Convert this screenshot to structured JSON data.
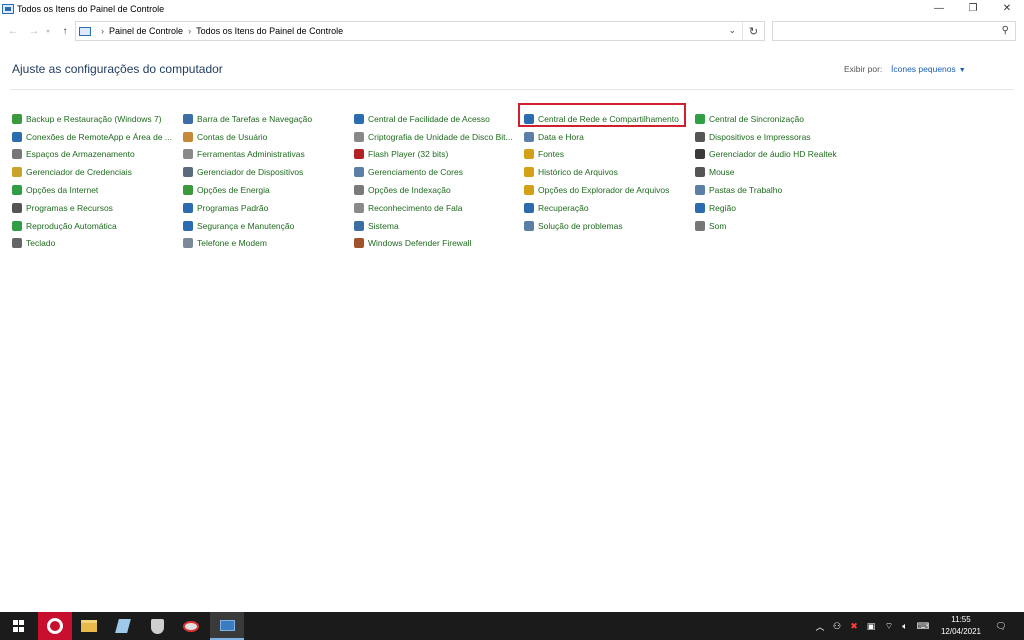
{
  "window": {
    "title": "Todos os Itens do Painel de Controle",
    "controls": [
      "minimize-icon",
      "restore-icon",
      "close-icon"
    ]
  },
  "address": {
    "crumbs": [
      "Painel de Controle",
      "Todos os Itens do Painel de Controle"
    ],
    "search_placeholder": ""
  },
  "header": {
    "title": "Ajuste as configurações do computador",
    "view_by_label": "Exibir por:",
    "view_by_value": "Ícones pequenos"
  },
  "columns": [
    [
      {
        "label": "Backup e Restauração (Windows 7)",
        "icon": "backup-icon",
        "color": "#3c9a3c"
      },
      {
        "label": "Conexões de RemoteApp e Área de ...",
        "icon": "remoteapp-icon",
        "color": "#2b6cb0"
      },
      {
        "label": "Espaços de Armazenamento",
        "icon": "storage-icon",
        "color": "#777777"
      },
      {
        "label": "Gerenciador de Credenciais",
        "icon": "credentials-icon",
        "color": "#c9a227"
      },
      {
        "label": "Opções da Internet",
        "icon": "internet-icon",
        "color": "#2f9e44"
      },
      {
        "label": "Programas e Recursos",
        "icon": "programs-icon",
        "color": "#555555"
      },
      {
        "label": "Reprodução Automática",
        "icon": "autoplay-icon",
        "color": "#2f9e44"
      },
      {
        "label": "Teclado",
        "icon": "keyboard-icon",
        "color": "#666666"
      }
    ],
    [
      {
        "label": "Barra de Tarefas e Navegação",
        "icon": "taskbar-icon",
        "color": "#3b6ea5"
      },
      {
        "label": "Contas de Usuário",
        "icon": "users-icon",
        "color": "#c48a3a"
      },
      {
        "label": "Ferramentas Administrativas",
        "icon": "admin-tools-icon",
        "color": "#8a8a8a"
      },
      {
        "label": "Gerenciador de Dispositivos",
        "icon": "device-manager-icon",
        "color": "#5a6b7d"
      },
      {
        "label": "Opções de Energia",
        "icon": "power-icon",
        "color": "#3c9a3c"
      },
      {
        "label": "Programas Padrão",
        "icon": "default-programs-icon",
        "color": "#2b6cb0"
      },
      {
        "label": "Segurança e Manutenção",
        "icon": "flag-icon",
        "color": "#2b6cb0"
      },
      {
        "label": "Telefone e Modem",
        "icon": "phone-icon",
        "color": "#7a8a9a"
      }
    ],
    [
      {
        "label": "Central de Facilidade de Acesso",
        "icon": "ease-access-icon",
        "color": "#2b6cb0"
      },
      {
        "label": "Criptografia de Unidade de Disco Bit...",
        "icon": "bitlocker-icon",
        "color": "#888888"
      },
      {
        "label": "Flash Player (32 bits)",
        "icon": "flash-icon",
        "color": "#b22222"
      },
      {
        "label": "Gerenciamento de Cores",
        "icon": "color-mgmt-icon",
        "color": "#5b7fa6"
      },
      {
        "label": "Opções de Indexação",
        "icon": "indexing-icon",
        "color": "#7a7a7a"
      },
      {
        "label": "Reconhecimento de Fala",
        "icon": "microphone-icon",
        "color": "#8a8a8a"
      },
      {
        "label": "Sistema",
        "icon": "system-icon",
        "color": "#3b6ea5"
      },
      {
        "label": "Windows Defender Firewall",
        "icon": "firewall-icon",
        "color": "#a0522d"
      }
    ],
    [
      {
        "label": "Central de Rede e Compartilhamento",
        "icon": "network-icon",
        "color": "#2b6cb0"
      },
      {
        "label": "Data e Hora",
        "icon": "date-time-icon",
        "color": "#5b7fa6"
      },
      {
        "label": "Fontes",
        "icon": "fonts-icon",
        "color": "#d4a017"
      },
      {
        "label": "Histórico de Arquivos",
        "icon": "file-history-icon",
        "color": "#d4a017"
      },
      {
        "label": "Opções do Explorador de Arquivos",
        "icon": "explorer-options-icon",
        "color": "#d4a017"
      },
      {
        "label": "Recuperação",
        "icon": "recovery-icon",
        "color": "#2b6cb0"
      },
      {
        "label": "Solução de problemas",
        "icon": "troubleshoot-icon",
        "color": "#5b7fa6"
      }
    ],
    [
      {
        "label": "Central de Sincronização",
        "icon": "sync-icon",
        "color": "#2f9e44"
      },
      {
        "label": "Dispositivos e Impressoras",
        "icon": "printer-icon",
        "color": "#555555"
      },
      {
        "label": "Gerenciador de áudio HD Realtek",
        "icon": "realtek-audio-icon",
        "color": "#3a3a3a"
      },
      {
        "label": "Mouse",
        "icon": "mouse-icon",
        "color": "#555555"
      },
      {
        "label": "Pastas de Trabalho",
        "icon": "work-folders-icon",
        "color": "#5b7fa6"
      },
      {
        "label": "Região",
        "icon": "region-icon",
        "color": "#2b6cb0"
      },
      {
        "label": "Som",
        "icon": "sound-icon",
        "color": "#777777"
      }
    ]
  ],
  "highlighted_item": "Central de Rede e Compartilhamento",
  "taskbar": {
    "apps": [
      "start-icon",
      "opera-icon",
      "file-explorer-icon",
      "notepad-icon",
      "shield-app-icon",
      "paint-icon",
      "control-panel-icon"
    ],
    "time": "11:55",
    "date": "12/04/2021"
  }
}
